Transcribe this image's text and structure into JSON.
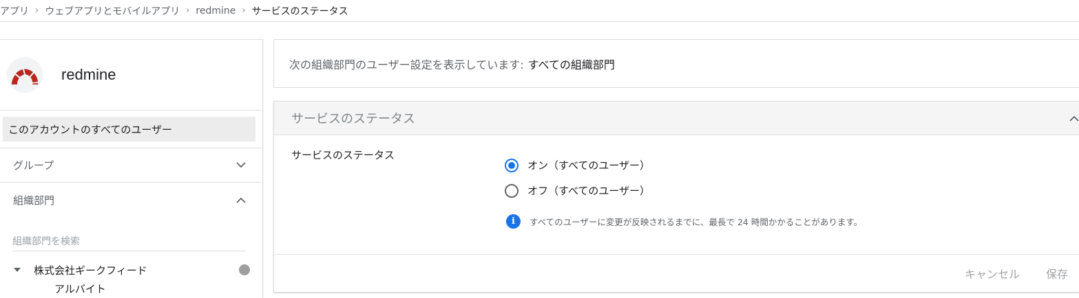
{
  "breadcrumb": {
    "items": [
      "アプリ",
      "ウェブアプリとモバイルアプリ",
      "redmine"
    ],
    "current": "サービスのステータス",
    "separator": "›"
  },
  "sidebar": {
    "app_name": "redmine",
    "app_icon": "redmine-logo-icon",
    "all_users_label": "このアカウントのすべてのユーザー",
    "groups_label": "グループ",
    "org_units_label": "組織部門",
    "search_placeholder": "組織部門を検索",
    "tree_root": "株式会社ギークフィード",
    "tree_child": "アルバイト"
  },
  "info": {
    "prefix": "次の組織部門のユーザー設定を表示しています:",
    "value": "すべての組織部門"
  },
  "service_status": {
    "header": "サービスのステータス",
    "setting_label": "サービスのステータス",
    "options": [
      {
        "label": "オン（すべてのユーザー）",
        "selected": true
      },
      {
        "label": "オフ（すべてのユーザー）",
        "selected": false
      }
    ],
    "notice": "すべてのユーザーに変更が反映されるまでに、最長で 24 時間かかることがあります。",
    "cancel_label": "キャンセル",
    "save_label": "保存"
  },
  "colors": {
    "accent": "#1a73e8",
    "logo_red": "#b8261f"
  }
}
